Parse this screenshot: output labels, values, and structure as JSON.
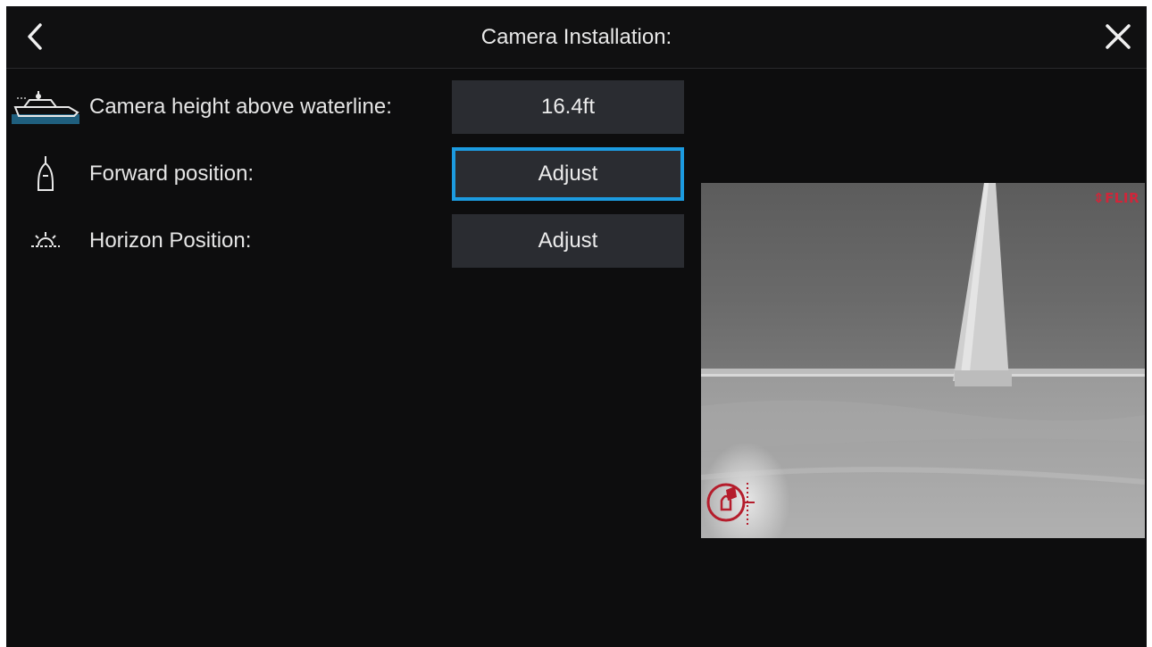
{
  "header": {
    "title": "Camera Installation:"
  },
  "settings": [
    {
      "icon": "boat-waterline-icon",
      "label": "Camera height above waterline:",
      "value": "16.4ft"
    },
    {
      "icon": "forward-position-icon",
      "label": "Forward position:",
      "value": "Adjust",
      "selected": true
    },
    {
      "icon": "horizon-sunrise-icon",
      "label": "Horizon Position:",
      "value": "Adjust"
    }
  ],
  "preview": {
    "logo": "FLIR"
  },
  "colors": {
    "background": "#0d0d0e",
    "button": "#2a2c31",
    "accent": "#1c9be0",
    "flir": "#d0263a"
  }
}
